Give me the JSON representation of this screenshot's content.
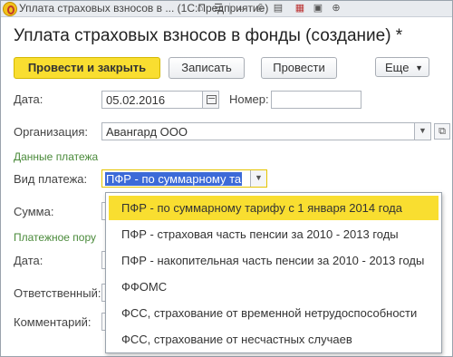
{
  "window": {
    "title": "Уплата страховых взносов в ...  (1С:Предприятие)",
    "icons": [
      "app-logo-icon",
      "home-icon",
      "menu-icon",
      "back-icon",
      "print-icon",
      "calendar-icon",
      "calc-icon",
      "zoom-icon"
    ]
  },
  "form": {
    "caption": "Уплата страховых взносов в фонды (создание) *",
    "buttons": {
      "post_close": "Провести и закрыть",
      "save": "Записать",
      "post": "Провести",
      "more": "Еще"
    }
  },
  "fields": {
    "date_label": "Дата:",
    "date_value": "05.02.2016",
    "number_label": "Номер:",
    "number_value": "",
    "org_label": "Организация:",
    "org_value": "Авангард ООО",
    "payment_group": "Данные платежа",
    "payment_type_label": "Вид платежа:",
    "payment_type_value": "ПФР - по суммарному та",
    "sum_label": "Сумма:",
    "payment_order_group": "Платежное пору",
    "order_date_label": "Дата:",
    "responsible_label": "Ответственный:",
    "comment_label": "Комментарий:"
  },
  "dropdown": {
    "items": [
      "ПФР - по суммарному тарифу с 1 января 2014 года",
      "ПФР - страховая часть пенсии за 2010 - 2013 годы",
      "ПФР - накопительная часть пенсии за 2010 - 2013 годы",
      "ФФОМС",
      "ФСС, страхование от временной нетрудоспособности",
      "ФСС, страхование от несчастных случаев"
    ],
    "selected_index": 0
  },
  "colors": {
    "accent": "#f9de30",
    "selection": "#3c6ad8",
    "group_label": "#4a8a3a"
  }
}
